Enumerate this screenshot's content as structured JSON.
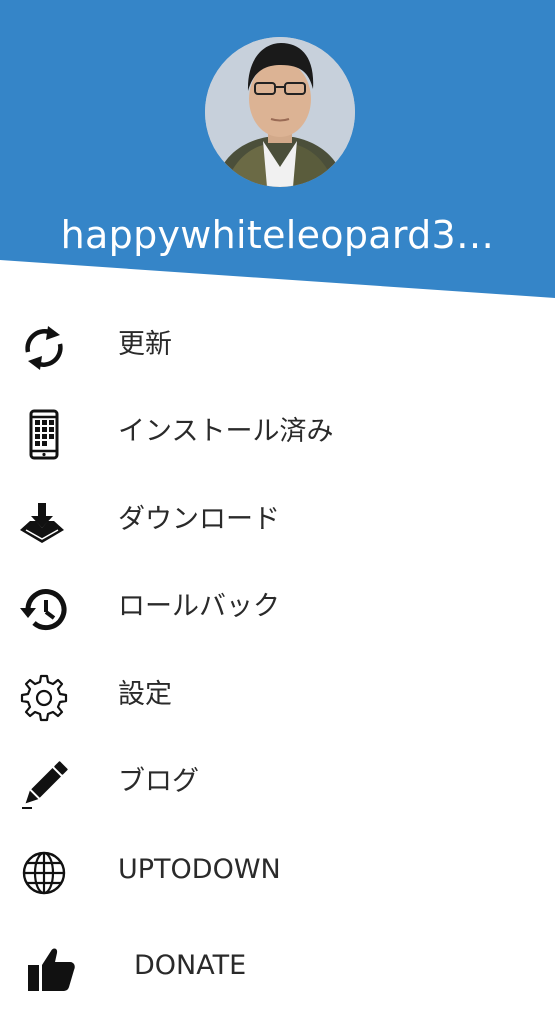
{
  "profile": {
    "username": "happywhiteleopard3…"
  },
  "colors": {
    "header": "#3585c8",
    "icon": "#111111",
    "label": "#2a2a2a"
  },
  "menu": [
    {
      "label": "更新",
      "icon": "refresh-icon"
    },
    {
      "label": "インストール済み",
      "icon": "phone-apps-icon"
    },
    {
      "label": "ダウンロード",
      "icon": "download-tray-icon"
    },
    {
      "label": "ロールバック",
      "icon": "history-icon"
    },
    {
      "label": "設定",
      "icon": "gear-icon"
    },
    {
      "label": "ブログ",
      "icon": "pencil-icon"
    },
    {
      "label": "UPTODOWN",
      "icon": "globe-icon"
    },
    {
      "label": "DONATE",
      "icon": "thumbs-up-icon"
    }
  ]
}
